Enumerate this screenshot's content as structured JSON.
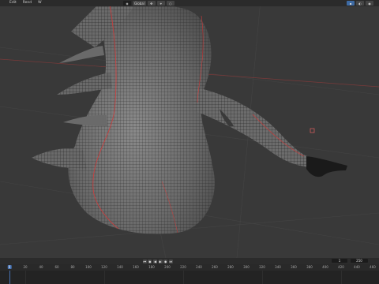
{
  "menu": {
    "items": [
      "File",
      "Edit",
      "Render",
      "Window",
      "Help"
    ],
    "items_shown": [
      "",
      "Edit",
      "Rend",
      "W"
    ]
  },
  "header": {
    "mode_label": "Global",
    "icons": [
      "cursor-icon",
      "move-icon",
      "rotate-icon",
      "snap-icon",
      "proportional-icon",
      "camera-icon",
      "view-icon"
    ]
  },
  "timeline": {
    "ruler_ticks": [
      "0",
      "20",
      "40",
      "60",
      "80",
      "100",
      "120",
      "140",
      "160",
      "180",
      "200",
      "220",
      "240",
      "260",
      "280",
      "300",
      "320",
      "340",
      "360",
      "380",
      "400",
      "420",
      "440",
      "460"
    ],
    "current_frame": "0",
    "start_frame": "1",
    "end_frame": "250",
    "playback_buttons": [
      "jump-start",
      "prev-key",
      "play-reverse",
      "play",
      "next-key",
      "jump-end"
    ]
  },
  "colors": {
    "viewport_bg": "#393939",
    "mesh_fill": "#6f6f6f",
    "wire": "#1a1a1a",
    "seam": "#d13a3a",
    "accent": "#4772b3"
  }
}
